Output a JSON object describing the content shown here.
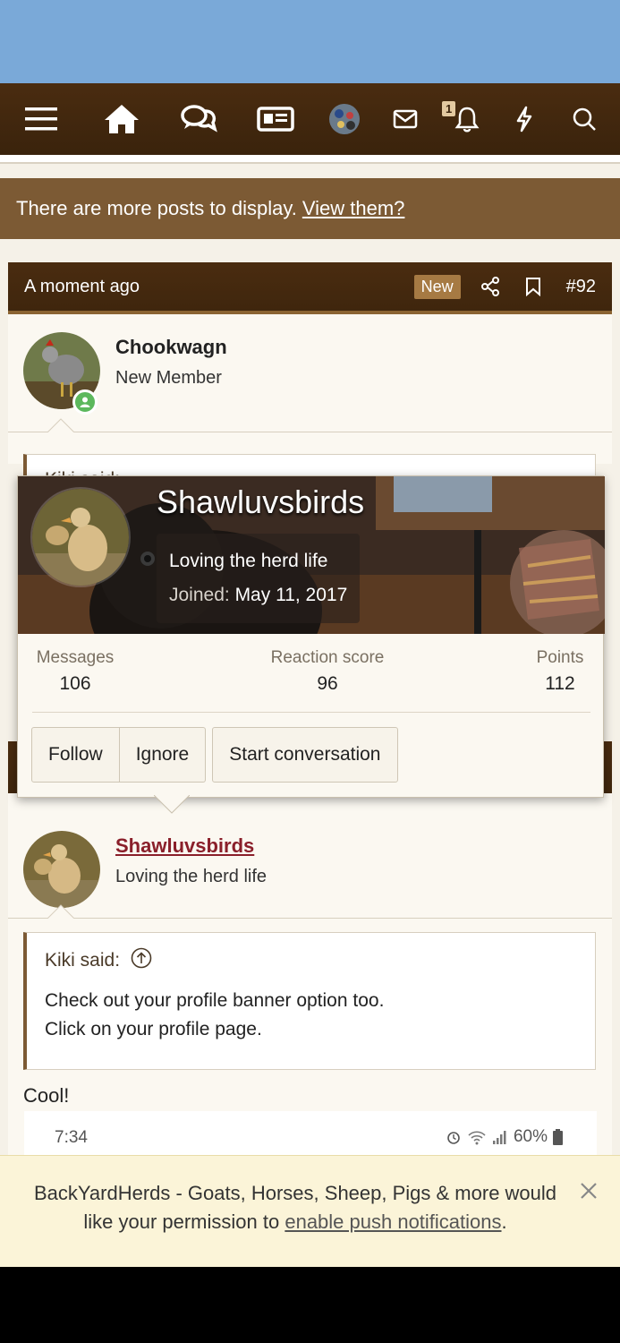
{
  "nav": {
    "notification_count": "1"
  },
  "more_posts": {
    "text": "There are more posts to display.",
    "link": "View them?"
  },
  "post92": {
    "time": "A moment ago",
    "badge": "New",
    "number": "#92",
    "user": {
      "name": "Chookwagn",
      "title": "New Member"
    },
    "quote_partial": "Kiki said:"
  },
  "popup": {
    "name": "Shawluvsbirds",
    "tagline": "Loving the herd life",
    "joined_label": "Joined:",
    "joined_date": "May 11, 2017",
    "stats": [
      {
        "label": "Messages",
        "value": "106"
      },
      {
        "label": "Reaction score",
        "value": "96"
      },
      {
        "label": "Points",
        "value": "112"
      }
    ],
    "buttons": {
      "follow": "Follow",
      "ignore": "Ignore",
      "start": "Start conversation"
    }
  },
  "post93": {
    "user": {
      "name": "Shawluvsbirds",
      "title": "Loving the herd life"
    },
    "quote": {
      "author": "Kiki said:",
      "line1": "Check out your profile banner option too.",
      "line2": "Click on your profile page."
    },
    "reply": "Cool!",
    "attachment": {
      "time": "7:34",
      "battery": "60%"
    }
  },
  "push": {
    "text_before": "BackYardHerds - Goats, Horses, Sheep, Pigs & more would like your permission to",
    "link": "enable push notifications",
    "text_after": "."
  },
  "colors": {
    "brown_dark": "#3f260d",
    "brown_mid": "#7c5a34",
    "cream": "#f5f1e8",
    "link_red": "#8a1f2a",
    "online_green": "#5cb85c"
  }
}
